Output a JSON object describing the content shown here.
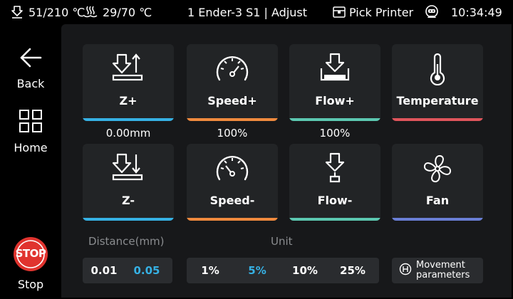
{
  "status": {
    "nozzle_temp": "51/210 ℃",
    "bed_temp": "29/70 ℃",
    "title": "1 Ender-3 S1 | Adjust",
    "pick_printer": "Pick Printer",
    "time": "10:34:49"
  },
  "sidebar": {
    "back_label": "Back",
    "home_label": "Home",
    "stop_label": "Stop",
    "stop_icon_text": "STOP"
  },
  "tiles": {
    "z_up": {
      "label": "Z+",
      "value": "0.00mm",
      "icon": "z-up-icon",
      "color": "#36b1e4"
    },
    "speed_up": {
      "label": "Speed+",
      "value": "100%",
      "icon": "speedometer-icon",
      "color": "#f08a3e"
    },
    "flow_up": {
      "label": "Flow+",
      "value": "100%",
      "icon": "flow-up-icon",
      "color": "#5cc8b1"
    },
    "temperature": {
      "label": "Temperature",
      "icon": "thermometer-icon",
      "color": "#e0555c"
    },
    "z_down": {
      "label": "Z-",
      "icon": "z-down-icon",
      "color": "#36b1e4"
    },
    "speed_down": {
      "label": "Speed-",
      "icon": "speedometer-icon",
      "color": "#f08a3e"
    },
    "flow_down": {
      "label": "Flow-",
      "icon": "flow-down-icon",
      "color": "#5cc8b1"
    },
    "fan": {
      "label": "Fan",
      "icon": "fan-icon",
      "color": "#6a7fd6"
    }
  },
  "distance": {
    "title": "Distance(mm)",
    "options": [
      "0.01",
      "0.05"
    ],
    "selected": "0.05"
  },
  "unit": {
    "title": "Unit",
    "options": [
      "1%",
      "5%",
      "10%",
      "25%"
    ],
    "selected": "5%"
  },
  "movement": {
    "line1": "Movement",
    "line2": "parameters"
  },
  "colors": {
    "accent_selected": "#36b1e4",
    "stop_red": "#e0332e"
  }
}
